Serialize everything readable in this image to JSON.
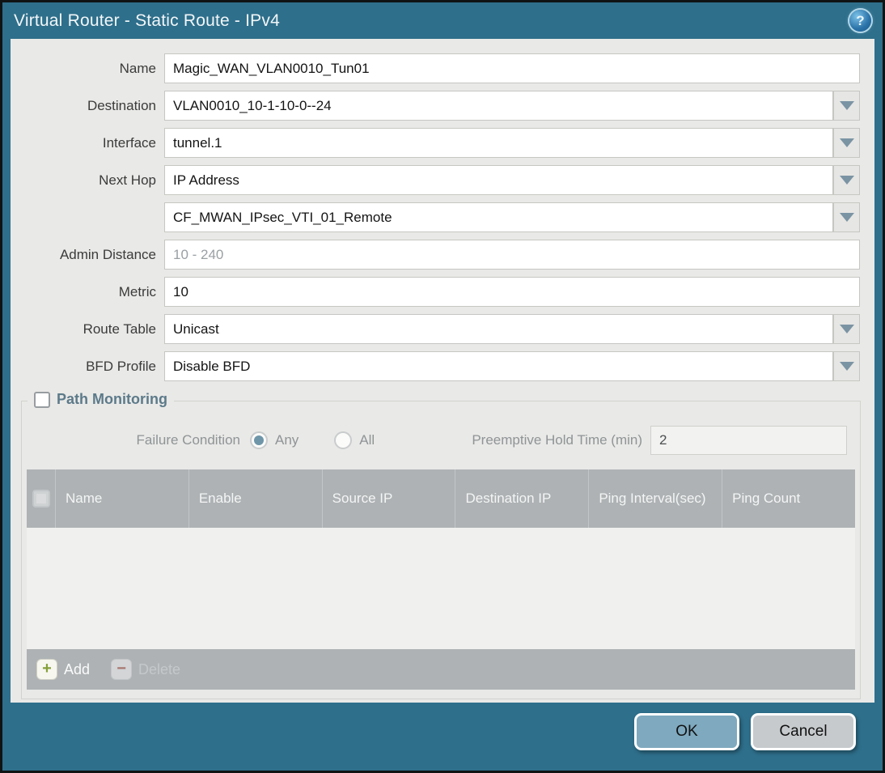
{
  "window": {
    "title": "Virtual Router - Static Route - IPv4",
    "help_glyph": "?",
    "colors": {
      "frame_teal": "#2e6f8b",
      "body_gray": "#e9e9e7",
      "table_header_gray": "#aeb2b4",
      "ok_button_blue": "#7ea9be",
      "cancel_button_gray": "#c7cacc",
      "pm_title_slate": "#5c7a8a"
    }
  },
  "form": {
    "fields": [
      {
        "label": "Name",
        "value": "Magic_WAN_VLAN0010_Tun01",
        "type": "text"
      },
      {
        "label": "Destination",
        "value": "VLAN0010_10-1-10-0--24",
        "type": "dropdown"
      },
      {
        "label": "Interface",
        "value": "tunnel.1",
        "type": "dropdown"
      },
      {
        "label": "Next Hop",
        "value": "IP Address",
        "type": "dropdown"
      },
      {
        "label": "",
        "value": "CF_MWAN_IPsec_VTI_01_Remote",
        "type": "dropdown"
      },
      {
        "label": "Admin Distance",
        "value": "",
        "placeholder": "10 - 240",
        "type": "text"
      },
      {
        "label": "Metric",
        "value": "10",
        "type": "text"
      },
      {
        "label": "Route Table",
        "value": "Unicast",
        "type": "dropdown"
      },
      {
        "label": "BFD Profile",
        "value": "Disable BFD",
        "type": "dropdown"
      }
    ]
  },
  "path_monitoring": {
    "title": "Path Monitoring",
    "checkbox_checked": false,
    "failure_condition_label": "Failure Condition",
    "options": [
      {
        "label": "Any",
        "selected": true
      },
      {
        "label": "All",
        "selected": false
      }
    ],
    "hold_time_label": "Preemptive Hold Time (min)",
    "hold_time_value": "2",
    "table": {
      "columns": [
        "Name",
        "Enable",
        "Source IP",
        "Destination IP",
        "Ping Interval(sec)",
        "Ping Count"
      ],
      "rows": []
    },
    "add_label": "Add",
    "delete_label": "Delete",
    "add_glyph": "+",
    "delete_glyph": "−"
  },
  "footer": {
    "ok_label": "OK",
    "cancel_label": "Cancel"
  }
}
